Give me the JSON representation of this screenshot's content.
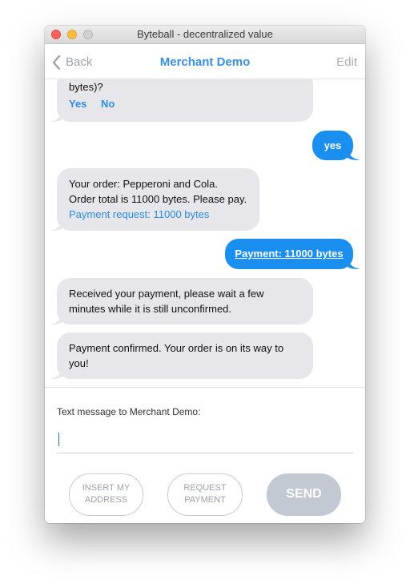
{
  "window": {
    "title": "Byteball - decentralized value"
  },
  "navbar": {
    "back_label": "Back",
    "title": "Merchant Demo",
    "edit_label": "Edit"
  },
  "messages": [
    {
      "direction": "in",
      "text_lines": [
        "bytes)?"
      ],
      "actions": [
        "Yes",
        "No"
      ]
    },
    {
      "direction": "out",
      "text": "yes"
    },
    {
      "direction": "in",
      "text_lines": [
        "Your order: Pepperoni and Cola.",
        "Order total is 11000 bytes. Please pay."
      ],
      "link": "Payment request: 11000 bytes"
    },
    {
      "direction": "out",
      "text": "Payment: 11000 bytes",
      "is_link": true
    },
    {
      "direction": "in",
      "text_lines": [
        "Received your payment, please wait a few",
        "minutes while it is still unconfirmed."
      ]
    },
    {
      "direction": "in",
      "text_lines": [
        "Payment confirmed. Your order is on its way to",
        "you!"
      ]
    }
  ],
  "composer": {
    "label": "Text message to Merchant Demo:",
    "value": "",
    "insert_address": [
      "INSERT MY",
      "ADDRESS"
    ],
    "request_payment": [
      "REQUEST",
      "PAYMENT"
    ],
    "send_label": "SEND"
  },
  "colors": {
    "accent": "#1a8ff0",
    "incoming_bubble": "#e6e6eb",
    "link": "#2b8de0",
    "send_disabled": "#c2c9d3"
  }
}
